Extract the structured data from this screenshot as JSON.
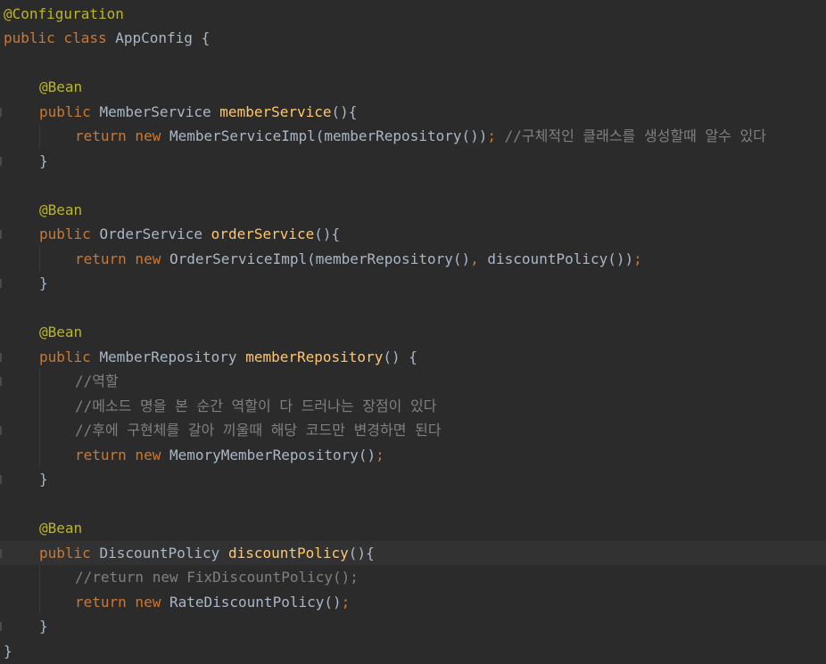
{
  "editor": {
    "language": "java",
    "lines": [
      {
        "indent": 0,
        "tokens": [
          {
            "t": "@Configuration",
            "c": "ann"
          }
        ]
      },
      {
        "indent": 0,
        "tokens": [
          {
            "t": "public class ",
            "c": "kw"
          },
          {
            "t": "AppConfig {",
            "c": "plain"
          }
        ]
      },
      {
        "indent": 0,
        "tokens": []
      },
      {
        "indent": 1,
        "tokens": [
          {
            "t": "@Bean",
            "c": "ann"
          }
        ]
      },
      {
        "indent": 1,
        "mark": true,
        "tokens": [
          {
            "t": "public ",
            "c": "kw"
          },
          {
            "t": "MemberService ",
            "c": "plain"
          },
          {
            "t": "memberService",
            "c": "fn"
          },
          {
            "t": "(){",
            "c": "plain"
          }
        ]
      },
      {
        "indent": 2,
        "tokens": [
          {
            "t": "return new ",
            "c": "kw"
          },
          {
            "t": "MemberServiceImpl(memberRepository())",
            "c": "plain"
          },
          {
            "t": "; ",
            "c": "kw"
          },
          {
            "t": "//구체적인 클래스를 생성할때 알수 있다",
            "c": "cmt"
          }
        ]
      },
      {
        "indent": 1,
        "mark": true,
        "tokens": [
          {
            "t": "}",
            "c": "plain"
          }
        ]
      },
      {
        "indent": 0,
        "tokens": []
      },
      {
        "indent": 1,
        "tokens": [
          {
            "t": "@Bean",
            "c": "ann"
          }
        ]
      },
      {
        "indent": 1,
        "mark": true,
        "tokens": [
          {
            "t": "public ",
            "c": "kw"
          },
          {
            "t": "OrderService ",
            "c": "plain"
          },
          {
            "t": "orderService",
            "c": "fn"
          },
          {
            "t": "(){",
            "c": "plain"
          }
        ]
      },
      {
        "indent": 2,
        "tokens": [
          {
            "t": "return new ",
            "c": "kw"
          },
          {
            "t": "OrderServiceImpl(memberRepository()",
            "c": "plain"
          },
          {
            "t": ", ",
            "c": "kw"
          },
          {
            "t": "discountPolicy())",
            "c": "plain"
          },
          {
            "t": ";",
            "c": "kw"
          }
        ]
      },
      {
        "indent": 1,
        "mark": true,
        "tokens": [
          {
            "t": "}",
            "c": "plain"
          }
        ]
      },
      {
        "indent": 0,
        "tokens": []
      },
      {
        "indent": 1,
        "tokens": [
          {
            "t": "@Bean",
            "c": "ann"
          }
        ]
      },
      {
        "indent": 1,
        "mark": true,
        "tokens": [
          {
            "t": "public ",
            "c": "kw"
          },
          {
            "t": "MemberRepository ",
            "c": "plain"
          },
          {
            "t": "memberRepository",
            "c": "fn"
          },
          {
            "t": "() {",
            "c": "plain"
          }
        ]
      },
      {
        "indent": 2,
        "mark": true,
        "tokens": [
          {
            "t": "//역할",
            "c": "cmt"
          }
        ]
      },
      {
        "indent": 2,
        "tokens": [
          {
            "t": "//메소드 명을 본 순간 역할이 다 드러나는 장점이 있다",
            "c": "cmt"
          }
        ]
      },
      {
        "indent": 2,
        "mark": true,
        "tokens": [
          {
            "t": "//후에 구현체를 갈아 끼울때 해당 코드만 변경하면 된다",
            "c": "cmt"
          }
        ]
      },
      {
        "indent": 2,
        "tokens": [
          {
            "t": "return new ",
            "c": "kw"
          },
          {
            "t": "MemoryMemberRepository()",
            "c": "plain"
          },
          {
            "t": ";",
            "c": "kw"
          }
        ]
      },
      {
        "indent": 1,
        "mark": true,
        "tokens": [
          {
            "t": "}",
            "c": "plain"
          }
        ]
      },
      {
        "indent": 0,
        "tokens": []
      },
      {
        "indent": 1,
        "tokens": [
          {
            "t": "@Bean",
            "c": "ann"
          }
        ]
      },
      {
        "indent": 1,
        "mark": true,
        "current": true,
        "tokens": [
          {
            "t": "public ",
            "c": "kw"
          },
          {
            "t": "DiscountPolicy ",
            "c": "plain"
          },
          {
            "t": "discountPolicy",
            "c": "fn"
          },
          {
            "t": "(){",
            "c": "plain"
          }
        ]
      },
      {
        "indent": 2,
        "tokens": [
          {
            "t": "//return new FixDiscountPolicy();",
            "c": "cmt"
          }
        ]
      },
      {
        "indent": 2,
        "tokens": [
          {
            "t": "return new ",
            "c": "kw"
          },
          {
            "t": "RateDiscountPolicy()",
            "c": "plain"
          },
          {
            "t": ";",
            "c": "kw"
          }
        ]
      },
      {
        "indent": 1,
        "mark": true,
        "tokens": [
          {
            "t": "}",
            "c": "plain"
          }
        ]
      },
      {
        "indent": 0,
        "tokens": [
          {
            "t": "}",
            "c": "plain"
          }
        ]
      }
    ]
  }
}
